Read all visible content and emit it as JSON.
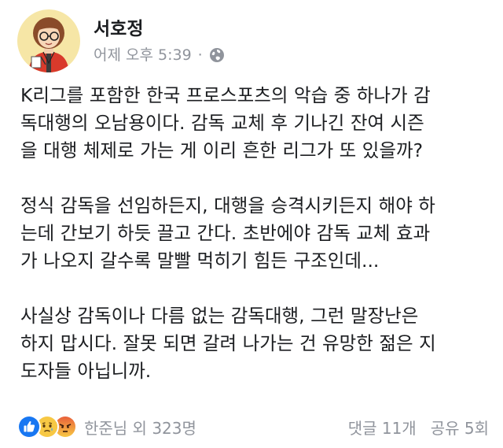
{
  "post": {
    "author": "서호정",
    "timestamp": "어제 오후 5:39",
    "separator": "·",
    "privacy_icon": "globe-icon",
    "paragraphs": [
      "K리그를 포함한 한국 프로스포츠의 악습 중 하나가 감\n독대행의 오남용이다. 감독 교체 후 기나긴 잔여 시즌\n을 대행 체제로 가는 게 이리 흔한 리그가 또 있을까?",
      "정식 감독을 선임하든지, 대행을 승격시키든지 해야 하\n는데 간보기 하듯 끌고 간다. 초반에야 감독 교체 효과\n가 나오지 갈수록 말빨 먹히기 힘든 구조인데...",
      "사실상 감독이나 다름 없는 감독대행, 그런 말장난은\n하지 맙시다. 잘못 되면 갈려 나가는 건 유망한 젊은 지\n도자들 아닙니까."
    ]
  },
  "footer": {
    "reaction_icons": [
      "like-icon",
      "sad-icon",
      "angry-icon"
    ],
    "reaction_summary": "한준님 외 323명",
    "comments": "댓글 11개",
    "shares": "공유 5회"
  },
  "colors": {
    "author": "#1c1e21",
    "meta": "#90949c",
    "like": "#1877f2",
    "sad": "#f7c844",
    "angry": "#e9603a"
  }
}
